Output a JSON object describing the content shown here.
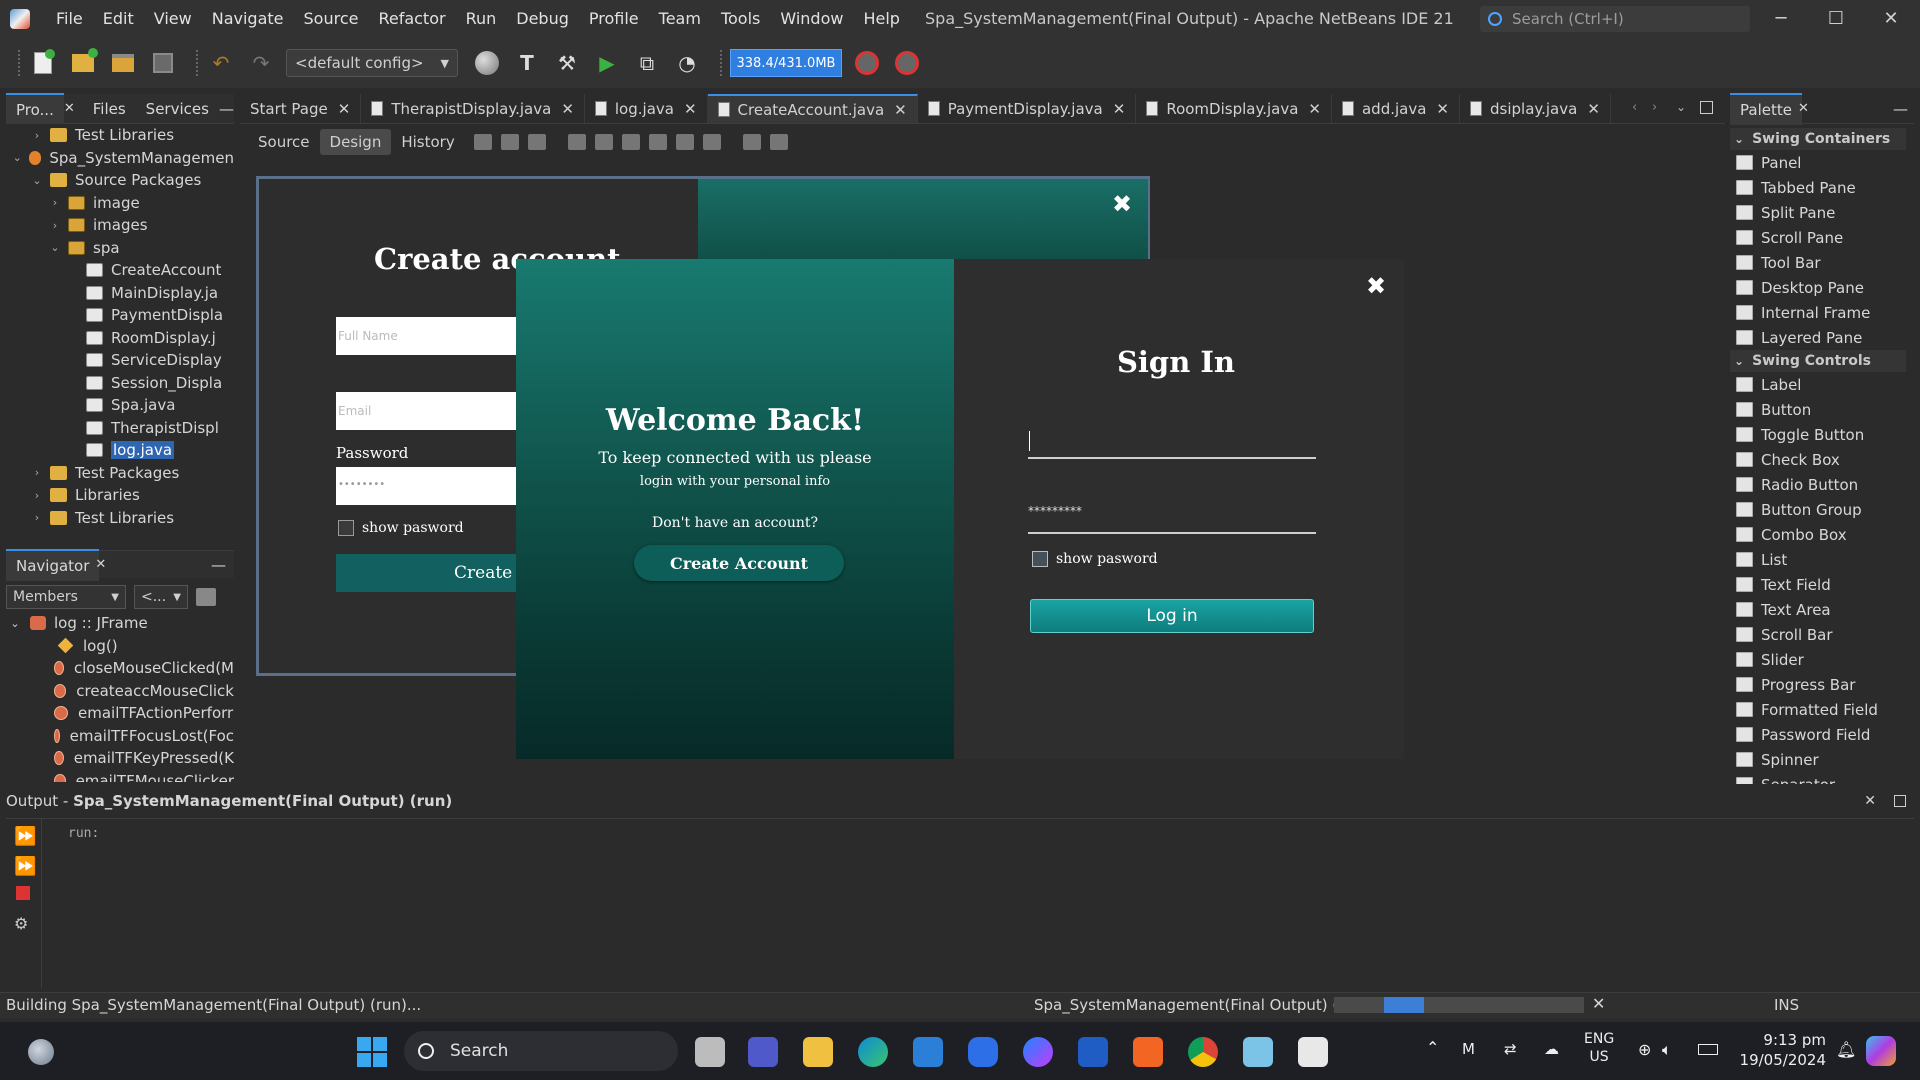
{
  "window": {
    "title": "Spa_SystemManagement(Final Output) - Apache NetBeans IDE 21",
    "search_placeholder": "Search (Ctrl+I)",
    "minimize": "─",
    "maximize": "☐",
    "close": "✕"
  },
  "menu": [
    "File",
    "Edit",
    "View",
    "Navigate",
    "Source",
    "Refactor",
    "Run",
    "Debug",
    "Profile",
    "Team",
    "Tools",
    "Window",
    "Help"
  ],
  "toolbar": {
    "config": "<default config>",
    "memory": "338.4/431.0MB"
  },
  "left_tabs": [
    "Pro...",
    "Files",
    "Services"
  ],
  "project_tree": [
    {
      "label": "Test Libraries",
      "indent": 1,
      "caret": "›",
      "icon": "folder"
    },
    {
      "label": "Spa_SystemManagemen",
      "indent": 0,
      "caret": "⌄",
      "icon": "proj"
    },
    {
      "label": "Source Packages",
      "indent": 1,
      "caret": "⌄",
      "icon": "folder"
    },
    {
      "label": "image",
      "indent": 2,
      "caret": "›",
      "icon": "pkg"
    },
    {
      "label": "images",
      "indent": 2,
      "caret": "›",
      "icon": "pkg"
    },
    {
      "label": "spa",
      "indent": 2,
      "caret": "⌄",
      "icon": "pkg"
    },
    {
      "label": "CreateAccount",
      "indent": 3,
      "caret": "",
      "icon": "jfile"
    },
    {
      "label": "MainDisplay.ja",
      "indent": 3,
      "caret": "",
      "icon": "jfile"
    },
    {
      "label": "PaymentDispla",
      "indent": 3,
      "caret": "",
      "icon": "jfile"
    },
    {
      "label": "RoomDisplay.j",
      "indent": 3,
      "caret": "",
      "icon": "jfile"
    },
    {
      "label": "ServiceDisplay",
      "indent": 3,
      "caret": "",
      "icon": "jfile"
    },
    {
      "label": "Session_Displa",
      "indent": 3,
      "caret": "",
      "icon": "jfile"
    },
    {
      "label": "Spa.java",
      "indent": 3,
      "caret": "",
      "icon": "jfile"
    },
    {
      "label": "TherapistDispl",
      "indent": 3,
      "caret": "",
      "icon": "jfile"
    },
    {
      "label": "log.java",
      "indent": 3,
      "caret": "",
      "icon": "jfile",
      "selected": true
    },
    {
      "label": "Test Packages",
      "indent": 1,
      "caret": "›",
      "icon": "folder"
    },
    {
      "label": "Libraries",
      "indent": 1,
      "caret": "›",
      "icon": "folder"
    },
    {
      "label": "Test Libraries",
      "indent": 1,
      "caret": "›",
      "icon": "folder"
    }
  ],
  "navigator": {
    "title": "Navigator",
    "filter": "Members",
    "filter2": "<...",
    "root": "log :: JFrame",
    "members": [
      {
        "label": "log()",
        "kind": "ctor"
      },
      {
        "label": "closeMouseClicked(M",
        "kind": "method"
      },
      {
        "label": "createaccMouseClick",
        "kind": "method"
      },
      {
        "label": "emailTFActionPerforr",
        "kind": "method"
      },
      {
        "label": "emailTFFocusLost(Foc",
        "kind": "method"
      },
      {
        "label": "emailTFKeyPressed(K",
        "kind": "method"
      },
      {
        "label": "emailTFMouseClicker",
        "kind": "method"
      }
    ]
  },
  "editor_tabs": [
    {
      "label": "Start Page",
      "doc": false
    },
    {
      "label": "TherapistDisplay.java",
      "doc": true
    },
    {
      "label": "log.java",
      "doc": true
    },
    {
      "label": "CreateAccount.java",
      "doc": true,
      "active": true
    },
    {
      "label": "PaymentDisplay.java",
      "doc": true
    },
    {
      "label": "RoomDisplay.java",
      "doc": true
    },
    {
      "label": "add.java",
      "doc": true
    },
    {
      "label": "dsiplay.java",
      "doc": true
    }
  ],
  "design_tabs": [
    "Source",
    "Design",
    "History"
  ],
  "create_account_form": {
    "title": "Create account",
    "fullname_placeholder": "Full Name",
    "email_placeholder": "Email",
    "password_label": "Password",
    "password_value": "••••••••",
    "show_password": "show pasword",
    "create_button": "Create",
    "close": "✖"
  },
  "login_form": {
    "welcome_title": "Welcome Back!",
    "welcome_line1": "To keep connected with us please",
    "welcome_line2": "login with your personal info",
    "no_account": "Don't have an account?",
    "create_account_button": "Create Account",
    "signin_title": "Sign In",
    "password_value": "*********",
    "show_password": "show pasword",
    "login_button": "Log in",
    "close": "✖"
  },
  "palette": {
    "title": "Palette",
    "categories": [
      {
        "name": "Swing Containers",
        "items": [
          "Panel",
          "Tabbed Pane",
          "Split Pane",
          "Scroll Pane",
          "Tool Bar",
          "Desktop Pane",
          "Internal Frame",
          "Layered Pane"
        ]
      },
      {
        "name": "Swing Controls",
        "items": [
          "Label",
          "Button",
          "Toggle Button",
          "Check Box",
          "Radio Button",
          "Button Group",
          "Combo Box",
          "List",
          "Text Field",
          "Text Area",
          "Scroll Bar",
          "Slider",
          "Progress Bar",
          "Formatted Field",
          "Password Field",
          "Spinner",
          "Separator"
        ]
      }
    ]
  },
  "output": {
    "label": "Output - ",
    "title": "Spa_SystemManagement(Final Output) (run)",
    "text": "run:"
  },
  "status": {
    "left": "Building Spa_SystemManagement(Final Output) (run)...",
    "task": "Spa_SystemManagement(Final Output) (run)",
    "mode": "INS"
  },
  "taskbar": {
    "search": "Search",
    "lang1": "ENG",
    "lang2": "US",
    "time": "9:13 pm",
    "date": "19/05/2024"
  }
}
